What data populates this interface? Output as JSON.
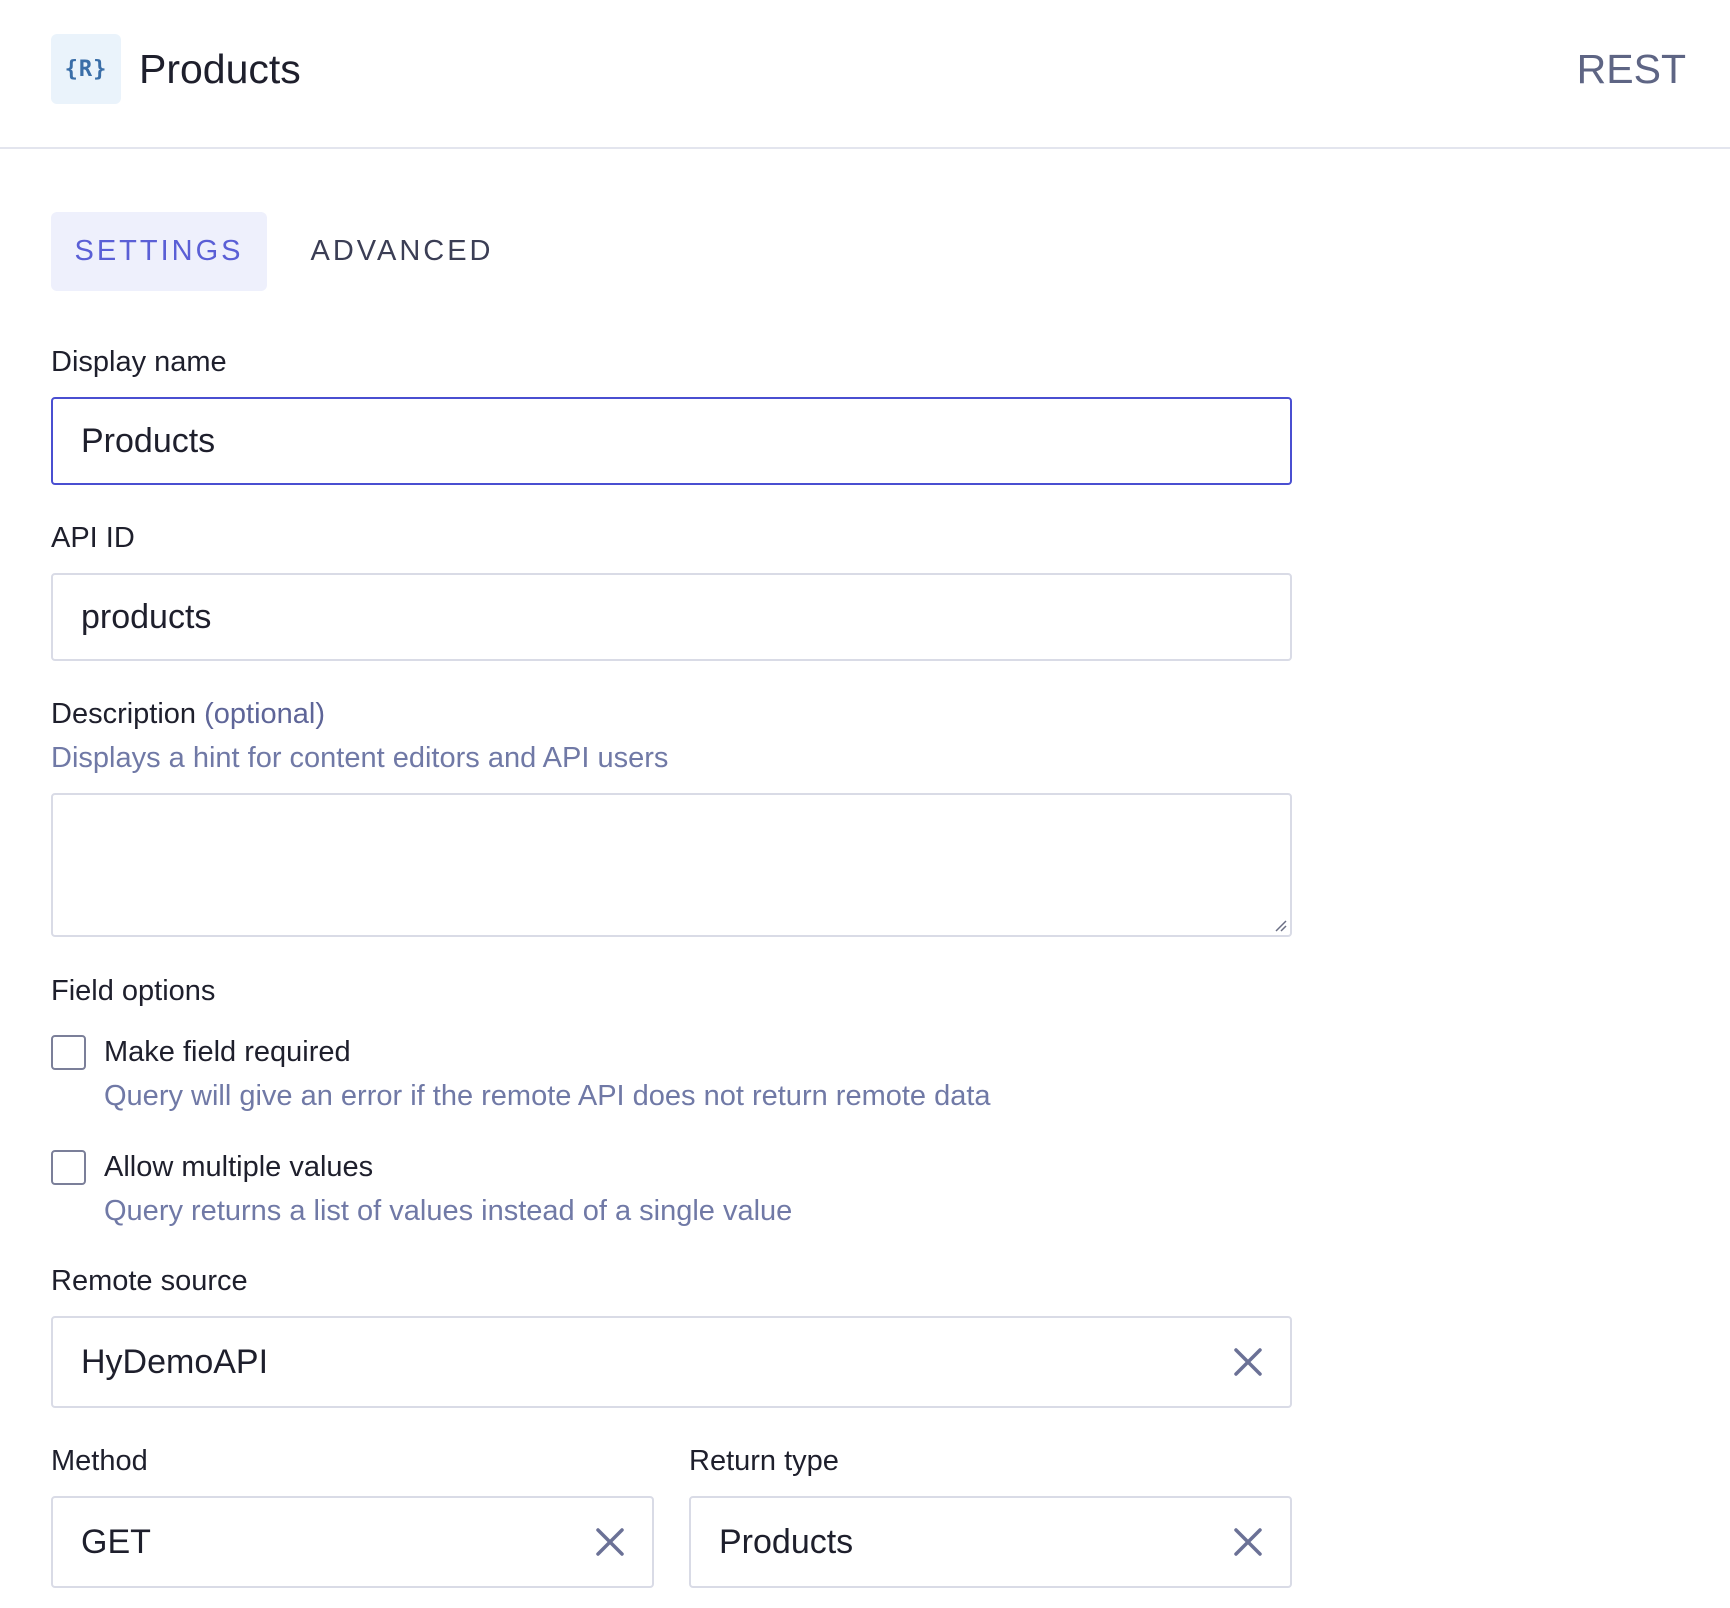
{
  "header": {
    "logo_text": "{R}",
    "title": "Products",
    "type_label": "REST"
  },
  "tabs": [
    {
      "label": "SETTINGS",
      "active": true
    },
    {
      "label": "ADVANCED",
      "active": false
    }
  ],
  "form": {
    "display_name": {
      "label": "Display name",
      "value": "Products"
    },
    "api_id": {
      "label": "API ID",
      "value": "products"
    },
    "description": {
      "label": "Description",
      "optional": "(optional)",
      "hint": "Displays a hint for content editors and API users",
      "value": ""
    },
    "field_options": {
      "label": "Field options",
      "options": [
        {
          "label": "Make field required",
          "hint": "Query will give an error if the remote API does not return remote data",
          "checked": false
        },
        {
          "label": "Allow multiple values",
          "hint": "Query returns a list of values instead of a single value",
          "checked": false
        }
      ]
    },
    "remote_source": {
      "label": "Remote source",
      "value": "HyDemoAPI"
    },
    "method": {
      "label": "Method",
      "value": "GET"
    },
    "return_type": {
      "label": "Return type",
      "value": "Products"
    }
  },
  "icons": {
    "clear": "close-icon",
    "resize": "resize-handle-icon"
  },
  "colors": {
    "accent": "#5a5fd6",
    "focus_border": "#4a4fd1",
    "hint_text": "#7079a6",
    "border": "#d9dbe6"
  }
}
